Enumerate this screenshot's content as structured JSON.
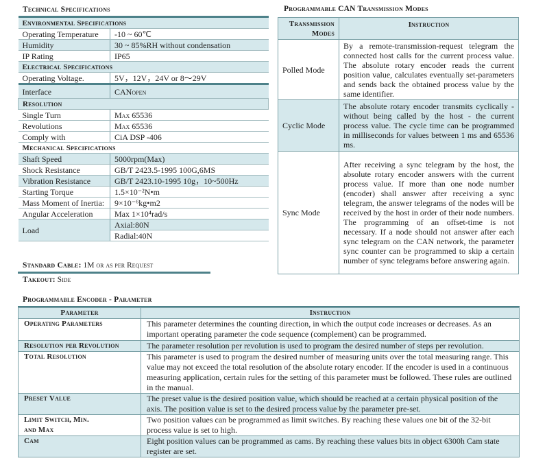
{
  "specs": {
    "title": "Technical Specifications",
    "environmental": "Environmental Specifications",
    "rows_env": [
      [
        "Operating Temperature",
        "-10 ~ 60℃"
      ],
      [
        "Humidity",
        "30 ~ 85%RH  without condensation"
      ],
      [
        "IP Rating",
        "IP65"
      ]
    ],
    "electrical": "Electrical Specifications",
    "voltage": [
      "Operating Voltage.",
      "5V，12V，24V or 8～29V"
    ],
    "interface": [
      "Interface",
      "CANopen"
    ],
    "resolution": "Resolution",
    "rows_res": [
      [
        "Single Turn",
        "Max 65536"
      ],
      [
        "Revolutions",
        "Max 65536"
      ],
      [
        "Comply with",
        "CiA DSP -406"
      ]
    ],
    "mechanical": "Mechanical Specifications",
    "rows_mech": [
      [
        "Shaft Speed",
        "5000rpm(Max)"
      ],
      [
        "Shock Resistance",
        "GB/T 2423.5-1995 100G,6MS"
      ],
      [
        "Vibration Resistance",
        "GB/T 2423.10-1995 10g，10~500Hz"
      ],
      [
        "Starting Torque",
        "1.5×10⁻²N•m"
      ],
      [
        "Mass Moment of Inertia:",
        "9×10⁻⁶kg•m2"
      ],
      [
        "Angular Acceleration",
        "Max 1×10⁴rad/s"
      ]
    ],
    "load": {
      "label": "Load",
      "axial": "Axial:80N",
      "radial": "Radial:40N"
    }
  },
  "cable": {
    "label": "Standard Cable:",
    "value": "1M or as per Request"
  },
  "takeout": {
    "label": "Takeout:",
    "value": "Side"
  },
  "modes": {
    "title": "Programmable CAN Transmission Modes",
    "headers": [
      "Transmission Modes",
      "Instruction"
    ],
    "rows": [
      [
        "Polled Mode",
        "By a remote-transmission-request telegram the connected host calls for the current process value. The absolute rotary encoder reads the current position value, calculates eventually set-parameters and sends back the obtained process value by the same identifier."
      ],
      [
        "Cyclic Mode",
        "The absolute rotary encoder transmits cyclically - without being called by the host - the current process value. The cycle time can be programmed in milliseconds for values between 1 ms and 65536 ms."
      ],
      [
        "Sync Mode",
        "After receiving a sync telegram by the host, the absolute rotary encoder answers with the current process value. If more than one node number (encoder) shall answer after receiving a sync telegram, the answer telegrams of the nodes will be received by the host in order of their node numbers. The programming of an offset-time is not necessary. If a node should not answer after each sync telegram on the CAN network, the parameter sync counter can be programmed to skip a certain number of sync telegrams before answering again."
      ]
    ]
  },
  "param": {
    "title": "Programmable Encoder - Parameter",
    "headers": [
      "Parameter",
      "Instruction"
    ],
    "rows": [
      [
        "Operating Parameters",
        "This parameter determines the counting direction, in which the output code increases or decreases. As an important operating parameter the code sequence (complement) can be programmed."
      ],
      [
        "Resolution per Revolution",
        "The parameter resolution per revolution is used to program the desired number of steps per revolution."
      ],
      [
        "Total Resolution",
        "This parameter is used to program the desired number of measuring units over the total measuring range. This value may not exceed the total resolution of the absolute rotary encoder. If the encoder is used in a continuous measuring application, certain rules for the setting of this parameter must be followed. These rules are outlined in the manual."
      ],
      [
        "Preset Value",
        "The preset value is the desired position value, which should be reached at a certain physical position of the axis. The position value is set to the desired process value by the parameter pre-set."
      ],
      [
        "Limit Switch, Min. and Max",
        "Two position values can be programmed as limit switches. By reaching these values one bit of the 32-bit process value is set to high."
      ],
      [
        "Cam",
        "Eight position values can be programmed as cams. By reaching these values bits in object 6300h Cam state register are set."
      ]
    ]
  }
}
